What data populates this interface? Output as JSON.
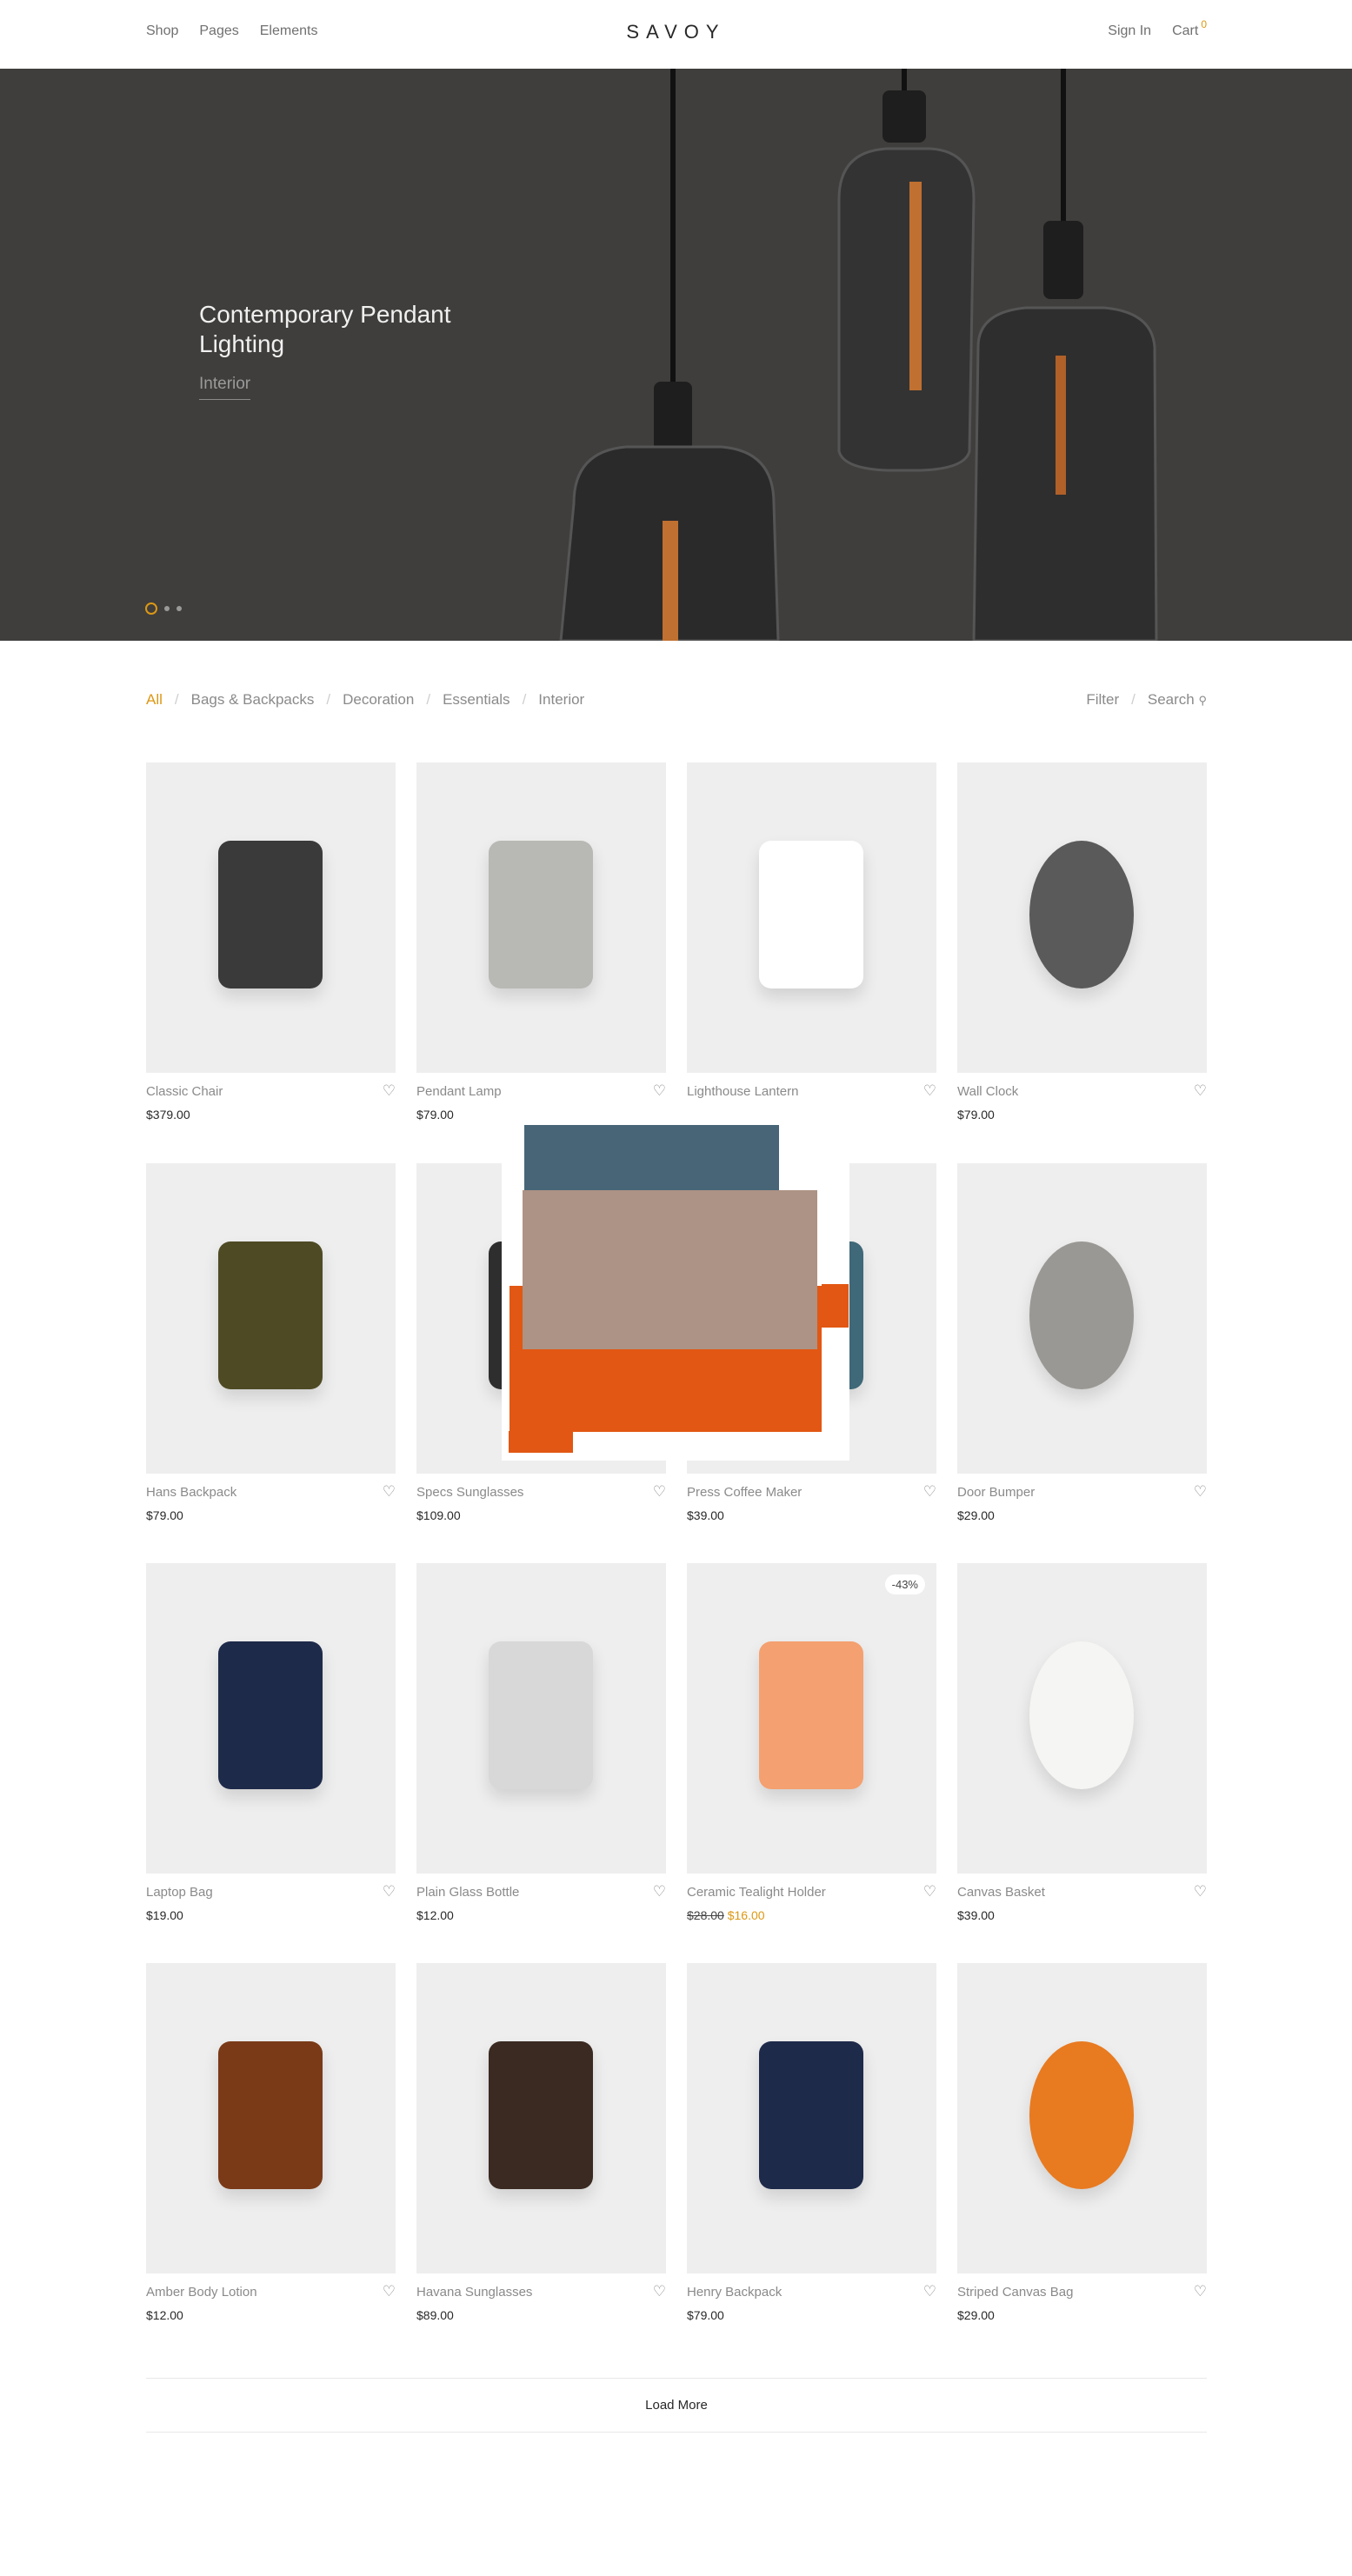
{
  "header": {
    "nav": [
      "Shop",
      "Pages",
      "Elements"
    ],
    "logo": "SAVOY",
    "sign_in": "Sign In",
    "cart": "Cart",
    "cart_count": "0"
  },
  "hero": {
    "title": "Contemporary Pendant Lighting",
    "link": "Interior",
    "slides": 3,
    "active_slide": 1
  },
  "filters": {
    "categories": [
      "All",
      "Bags & Backpacks",
      "Decoration",
      "Essentials",
      "Interior"
    ],
    "active": "All",
    "filter": "Filter",
    "search": "Search"
  },
  "colors": {
    "accent": "#dc9814",
    "hero_bg": "#3f3e3c",
    "card_bg": "#eeeeee"
  },
  "products": [
    {
      "name": "Classic Chair",
      "price": "$379.00",
      "color": "#3a3a3a"
    },
    {
      "name": "Pendant Lamp",
      "price": "$79.00",
      "color": "#b8b8b5"
    },
    {
      "name": "Lighthouse Lantern",
      "price": "",
      "color": "#ffffff"
    },
    {
      "name": "Wall Clock",
      "price": "$79.00",
      "color": "#5a5a5a"
    },
    {
      "name": "Hans Backpack",
      "price": "$79.00",
      "color": "#4e4a24"
    },
    {
      "name": "Specs Sunglasses",
      "price": "$109.00",
      "color": "#2e2e2e"
    },
    {
      "name": "Press Coffee Maker",
      "price": "$39.00",
      "color": "#3f6878"
    },
    {
      "name": "Door Bumper",
      "price": "$29.00",
      "color": "#9a9894"
    },
    {
      "name": "Laptop Bag",
      "price": "$19.00",
      "color": "#1e2a4a"
    },
    {
      "name": "Plain Glass Bottle",
      "price": "$12.00",
      "color": "#d8d8d8"
    },
    {
      "name": "Ceramic Tealight Holder",
      "old_price": "$28.00",
      "price": "$16.00",
      "badge": "-43%",
      "color": "#f4a070"
    },
    {
      "name": "Canvas Basket",
      "price": "$39.00",
      "color": "#f5f5f3"
    },
    {
      "name": "Amber Body Lotion",
      "price": "$12.00",
      "color": "#7a3a18"
    },
    {
      "name": "Havana Sunglasses",
      "price": "$89.00",
      "color": "#3a2a22"
    },
    {
      "name": "Henry Backpack",
      "price": "$79.00",
      "color": "#1e2a4a"
    },
    {
      "name": "Striped Canvas Bag",
      "price": "$29.00",
      "color": "#e87a20"
    }
  ],
  "load_more": "Load More"
}
